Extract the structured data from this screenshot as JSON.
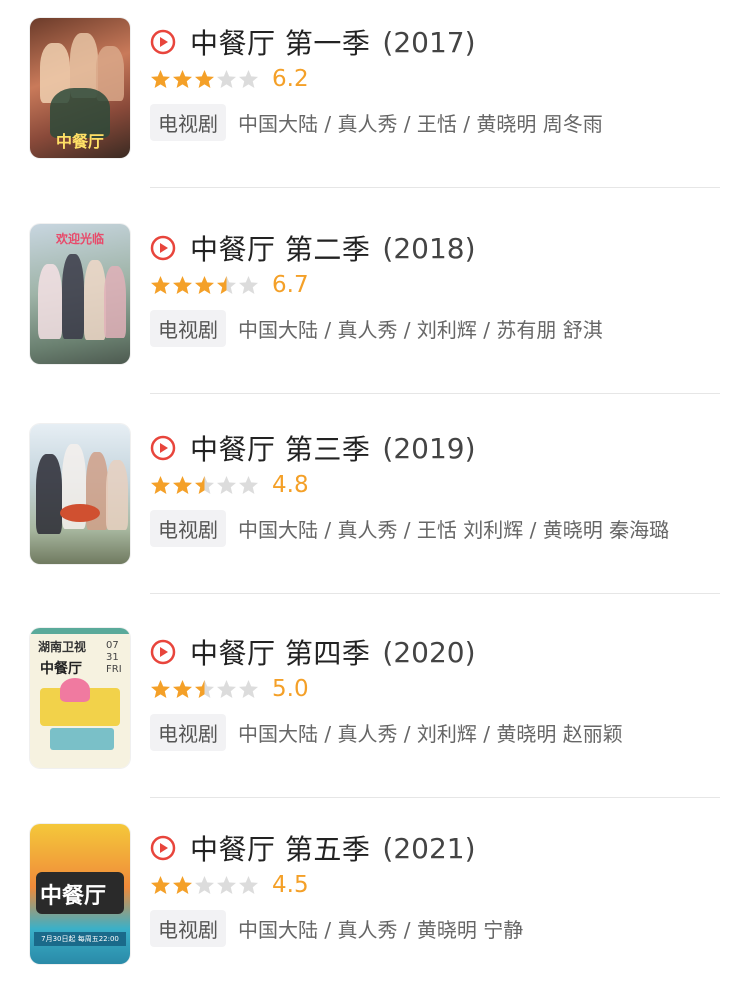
{
  "accent_color": "#f4a028",
  "play_icon_color": "#e8453c",
  "items": [
    {
      "title": "中餐厅 第一季",
      "year": "(2017)",
      "score": "6.2",
      "rating_fraction": 0.6,
      "tag": "电视剧",
      "meta": "中国大陆 / 真人秀 / 王恬 / 黄晓明 周冬雨",
      "poster_theme": "party"
    },
    {
      "title": "中餐厅 第二季",
      "year": "(2018)",
      "score": "6.7",
      "rating_fraction": 0.7,
      "tag": "电视剧",
      "meta": "中国大陆 / 真人秀 / 刘利辉 / 苏有朋 舒淇",
      "poster_theme": "garden"
    },
    {
      "title": "中餐厅 第三季",
      "year": "(2019)",
      "score": "4.8",
      "rating_fraction": 0.5,
      "tag": "电视剧",
      "meta": "中国大陆 / 真人秀 / 王恬 刘利辉 / 黄晓明 秦海璐",
      "poster_theme": "restaurant"
    },
    {
      "title": "中餐厅 第四季",
      "year": "(2020)",
      "score": "5.0",
      "rating_fraction": 0.5,
      "tag": "电视剧",
      "meta": "中国大陆 / 真人秀 / 刘利辉 / 黄晓明 赵丽颖",
      "poster_theme": "illustration",
      "poster_text": {
        "channel": "湖南卫视",
        "logo": "中餐厅",
        "date": "07 31 FRI"
      }
    },
    {
      "title": "中餐厅 第五季",
      "year": "(2021)",
      "score": "4.5",
      "rating_fraction": 0.4,
      "tag": "电视剧",
      "meta": "中国大陆 / 真人秀 / 黄晓明 宁静",
      "poster_theme": "truck",
      "poster_text": {
        "logo": "中餐厅",
        "schedule": "7月30日起 每周五22:00"
      }
    }
  ]
}
